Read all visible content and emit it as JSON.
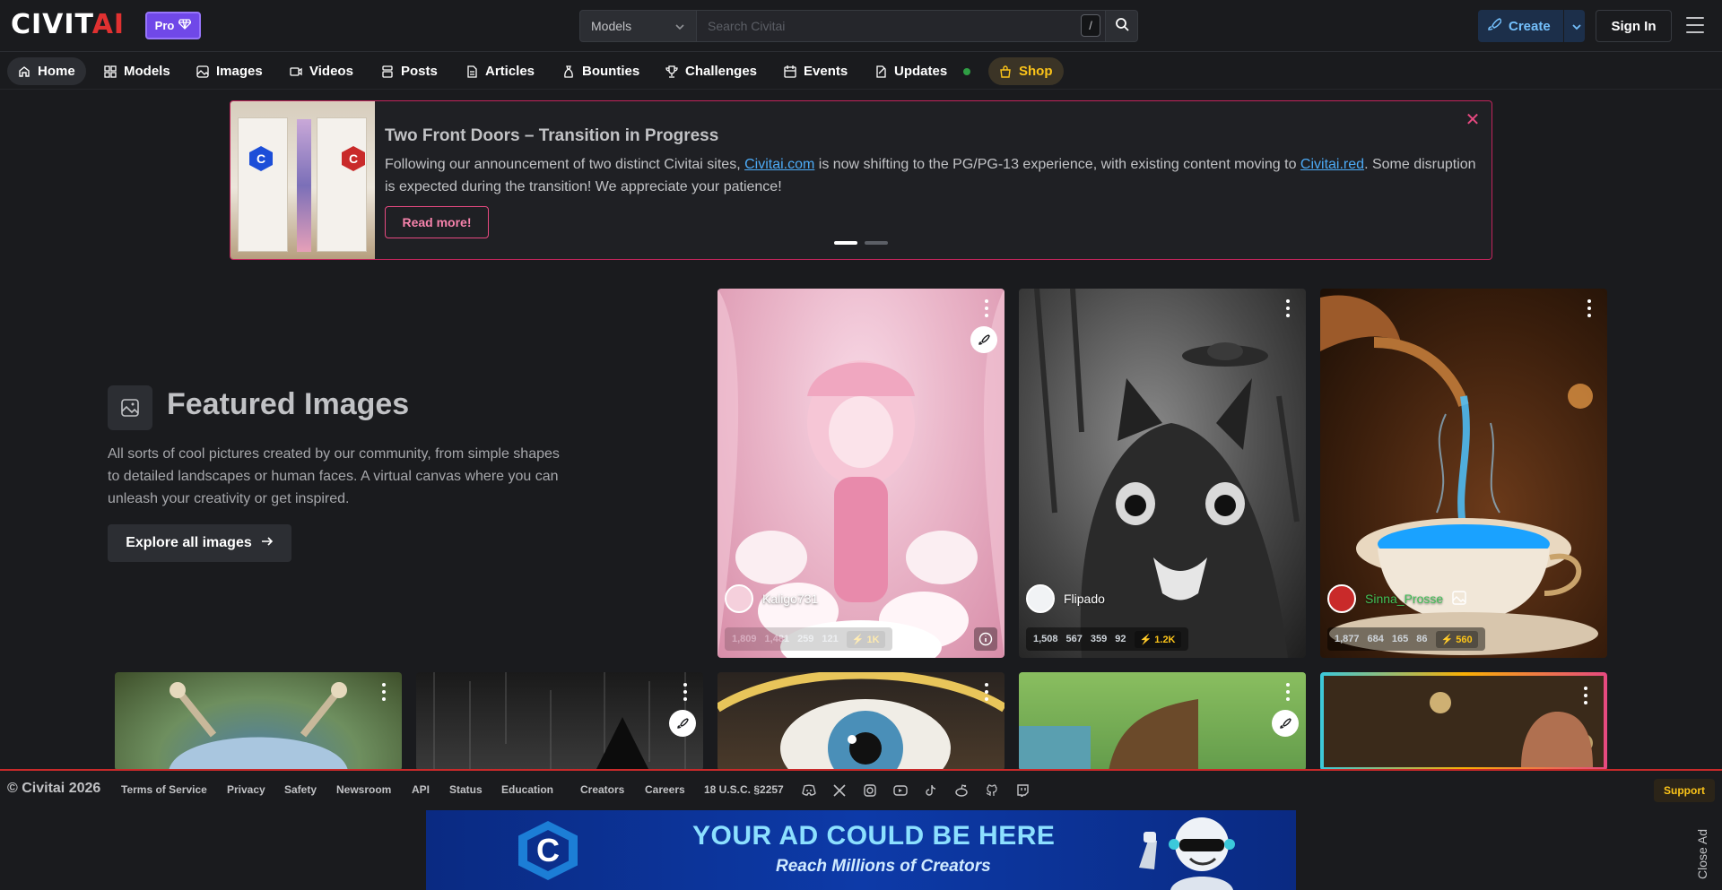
{
  "header": {
    "logo": "CIVITAI",
    "pro_label": "Pro",
    "search": {
      "type": "Models",
      "placeholder": "Search Civitai",
      "shortcut": "/"
    },
    "create_label": "Create",
    "signin_label": "Sign In"
  },
  "nav": {
    "items": [
      {
        "label": "Home",
        "icon": "home-icon"
      },
      {
        "label": "Models",
        "icon": "grid-icon"
      },
      {
        "label": "Images",
        "icon": "photo-icon"
      },
      {
        "label": "Videos",
        "icon": "video-icon"
      },
      {
        "label": "Posts",
        "icon": "posts-icon"
      },
      {
        "label": "Articles",
        "icon": "article-icon"
      },
      {
        "label": "Bounties",
        "icon": "moneybag-icon"
      },
      {
        "label": "Challenges",
        "icon": "trophy-icon"
      },
      {
        "label": "Events",
        "icon": "calendar-icon"
      },
      {
        "label": "Updates",
        "icon": "changelog-icon"
      },
      {
        "label": "Shop",
        "icon": "shopping-bag-icon"
      }
    ]
  },
  "banner": {
    "title": "Two Front Doors – Transition in Progress",
    "text_1": "Following our announcement of two distinct Civitai sites, ",
    "link_1": "Civitai.com",
    "text_2": " is now shifting to the PG/PG-13 experience, with existing content moving to ",
    "link_2": "Civitai.red",
    "text_3": ". Some disruption is expected during the transition! We appreciate your patience!",
    "button": "Read more!"
  },
  "featured": {
    "title": "Featured Images",
    "description": "All sorts of cool pictures created by our community, from simple shapes to detailed landscapes or human faces. A virtual canvas where you can unleash your creativity or get inspired.",
    "button": "Explore all images"
  },
  "cards": [
    {
      "creator": "Kaligo731",
      "stats": [
        "1,809",
        "1,481",
        "259",
        "121"
      ],
      "buzz": "1K"
    },
    {
      "creator": "Flipado",
      "stats": [
        "1,508",
        "567",
        "359",
        "92"
      ],
      "buzz": "1.2K"
    },
    {
      "creator": "Sinna_Prosse",
      "stats": [
        "1,877",
        "684",
        "165",
        "86"
      ],
      "buzz": "560"
    }
  ],
  "footer": {
    "copyright": "© Civitai 2026",
    "links": [
      "Terms of Service",
      "Privacy",
      "Safety",
      "Newsroom",
      "API",
      "Status",
      " Education",
      "Creators",
      "Careers",
      "18 U.S.C. §2257"
    ],
    "social": [
      "discord-icon",
      "x-icon",
      "instagram-icon",
      "youtube-icon",
      "tiktok-icon",
      "reddit-icon",
      "github-icon",
      "twitch-icon"
    ],
    "support": " Support"
  },
  "ad": {
    "title": "YOUR AD COULD BE HERE",
    "subtitle": "Reach Millions of Creators",
    "close": "Close Ad"
  },
  "colors": {
    "accent": "#e03131",
    "pro": "#7048e8",
    "banner_border": "#c2255c",
    "link": "#4dabf7",
    "buzz": "#fcc419"
  }
}
